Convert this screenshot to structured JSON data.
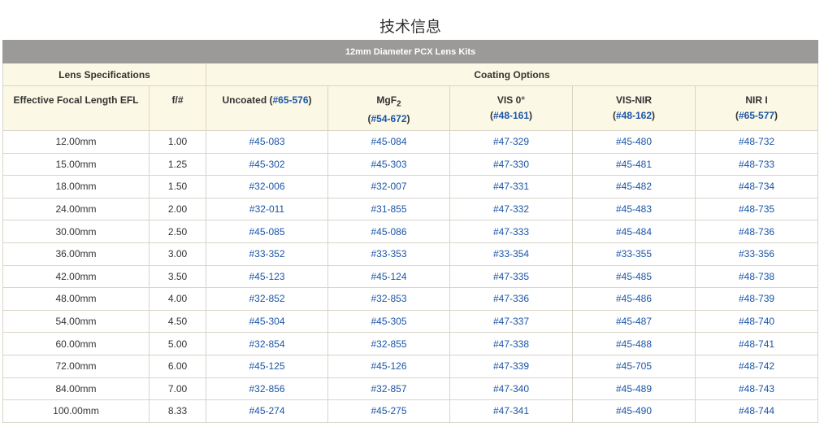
{
  "page_title": "技术信息",
  "table": {
    "caption": "12mm Diameter PCX Lens Kits",
    "group_lens_spec": "Lens Specifications",
    "group_coating": "Coating Options",
    "col_efl": "Effective Focal Length EFL",
    "col_fnum": "f/#",
    "col_uncoated_label": "Uncoated (",
    "col_uncoated_code": "#65-576",
    "col_uncoated_end": ")",
    "col_mgf2_label": "MgF",
    "col_mgf2_sub": "2",
    "col_mgf2_code": "#54-672",
    "col_vis0_label": "VIS 0°",
    "col_vis0_code": "#48-161",
    "col_visnir_label": "VIS-NIR",
    "col_visnir_code": "#48-162",
    "col_nir1_label": "NIR I",
    "col_nir1_code": "#65-577",
    "rows": [
      {
        "efl": "12.00mm",
        "fnum": "1.00",
        "uncoated": "#45-083",
        "mgf2": "#45-084",
        "vis0": "#47-329",
        "visnir": "#45-480",
        "nir1": "#48-732"
      },
      {
        "efl": "15.00mm",
        "fnum": "1.25",
        "uncoated": "#45-302",
        "mgf2": "#45-303",
        "vis0": "#47-330",
        "visnir": "#45-481",
        "nir1": "#48-733"
      },
      {
        "efl": "18.00mm",
        "fnum": "1.50",
        "uncoated": "#32-006",
        "mgf2": "#32-007",
        "vis0": "#47-331",
        "visnir": "#45-482",
        "nir1": "#48-734"
      },
      {
        "efl": "24.00mm",
        "fnum": "2.00",
        "uncoated": "#32-011",
        "mgf2": "#31-855",
        "vis0": "#47-332",
        "visnir": "#45-483",
        "nir1": "#48-735"
      },
      {
        "efl": "30.00mm",
        "fnum": "2.50",
        "uncoated": "#45-085",
        "mgf2": "#45-086",
        "vis0": "#47-333",
        "visnir": "#45-484",
        "nir1": "#48-736"
      },
      {
        "efl": "36.00mm",
        "fnum": "3.00",
        "uncoated": "#33-352",
        "mgf2": "#33-353",
        "vis0": "#33-354",
        "visnir": "#33-355",
        "nir1": "#33-356"
      },
      {
        "efl": "42.00mm",
        "fnum": "3.50",
        "uncoated": "#45-123",
        "mgf2": "#45-124",
        "vis0": "#47-335",
        "visnir": "#45-485",
        "nir1": "#48-738"
      },
      {
        "efl": "48.00mm",
        "fnum": "4.00",
        "uncoated": "#32-852",
        "mgf2": "#32-853",
        "vis0": "#47-336",
        "visnir": "#45-486",
        "nir1": "#48-739"
      },
      {
        "efl": "54.00mm",
        "fnum": "4.50",
        "uncoated": "#45-304",
        "mgf2": "#45-305",
        "vis0": "#47-337",
        "visnir": "#45-487",
        "nir1": "#48-740"
      },
      {
        "efl": "60.00mm",
        "fnum": "5.00",
        "uncoated": "#32-854",
        "mgf2": "#32-855",
        "vis0": "#47-338",
        "visnir": "#45-488",
        "nir1": "#48-741"
      },
      {
        "efl": "72.00mm",
        "fnum": "6.00",
        "uncoated": "#45-125",
        "mgf2": "#45-126",
        "vis0": "#47-339",
        "visnir": "#45-705",
        "nir1": "#48-742"
      },
      {
        "efl": "84.00mm",
        "fnum": "7.00",
        "uncoated": "#32-856",
        "mgf2": "#32-857",
        "vis0": "#47-340",
        "visnir": "#45-489",
        "nir1": "#48-743"
      },
      {
        "efl": "100.00mm",
        "fnum": "8.33",
        "uncoated": "#45-274",
        "mgf2": "#45-275",
        "vis0": "#47-341",
        "visnir": "#45-490",
        "nir1": "#48-744"
      }
    ]
  },
  "colors": {
    "header_bar": "#9b9a98",
    "header_bg": "#fcf8e6",
    "link": "#1a55a8",
    "border": "#d9d4c8"
  }
}
